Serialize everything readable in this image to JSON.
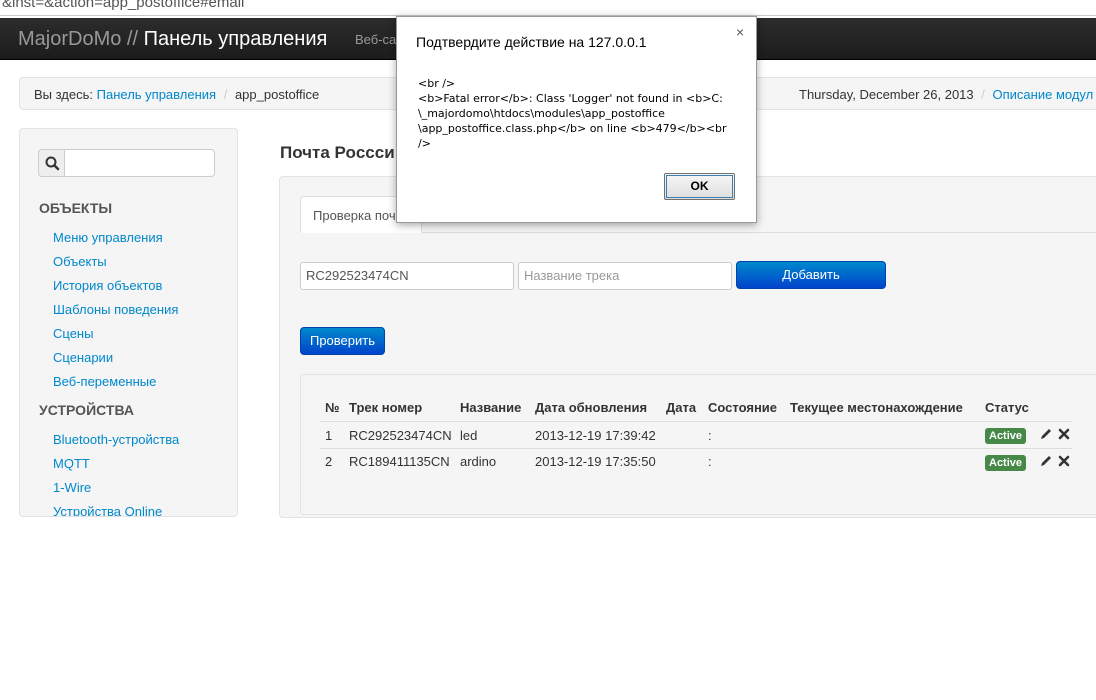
{
  "browser": {
    "url_fragment": "&inst=&action=app_postoffice#email"
  },
  "navbar": {
    "brand": "MajorDoMo",
    "separator": "//",
    "title": "Панель управления",
    "link": "Веб-са"
  },
  "breadcrumb": {
    "prefix": "Вы здесь:",
    "home": "Панель управления",
    "divider": "/",
    "current": "app_postoffice",
    "date": "Thursday, December 26, 2013",
    "module_link": "Описание модул"
  },
  "sidebar": {
    "search_placeholder": "",
    "sections": [
      {
        "header": "ОБЪЕКТЫ",
        "items": [
          "Меню управления",
          "Объекты",
          "История объектов",
          "Шаблоны поведения",
          "Сцены",
          "Сценарии",
          "Веб-переменные"
        ]
      },
      {
        "header": "УСТРОЙСТВА",
        "items": [
          "Bluetooth-устройства",
          "MQTT",
          "1-Wire",
          "Устройства Online"
        ]
      }
    ]
  },
  "main": {
    "title": "Почта Роccси",
    "tab": "Проверка почт",
    "track_input_value": "RC292523474CN",
    "name_input_placeholder": "Название трека",
    "add_button": "Добавить",
    "check_button": "Проверить",
    "table": {
      "headers": [
        "№",
        "Трек номер",
        "Название",
        "Дата обновления",
        "Дата",
        "Состояние",
        "Текущее местонахождение",
        "Статус"
      ],
      "rows": [
        {
          "num": "1",
          "track": "RC292523474CN",
          "name": "led",
          "updated": "2013-12-19 17:39:42",
          "date": "",
          "state": ":",
          "location": "",
          "status": "Active"
        },
        {
          "num": "2",
          "track": "RC189411135CN",
          "name": "ardino",
          "updated": "2013-12-19 17:35:50",
          "date": "",
          "state": ":",
          "location": "",
          "status": "Active"
        }
      ]
    }
  },
  "dialog": {
    "title": "Подтвердите действие на 127.0.0.1",
    "close": "×",
    "message": "<br />\n<b>Fatal error</b>:  Class 'Logger' not found in <b>C:\n\\_majordomo\\htdocs\\modules\\app_postoffice\n\\app_postoffice.class.php</b> on line <b>479</b><br />",
    "ok": "OK"
  },
  "colors": {
    "link": "#0088cc",
    "primary": "#0055cc",
    "success": "#468847",
    "navbar": "#222222"
  }
}
